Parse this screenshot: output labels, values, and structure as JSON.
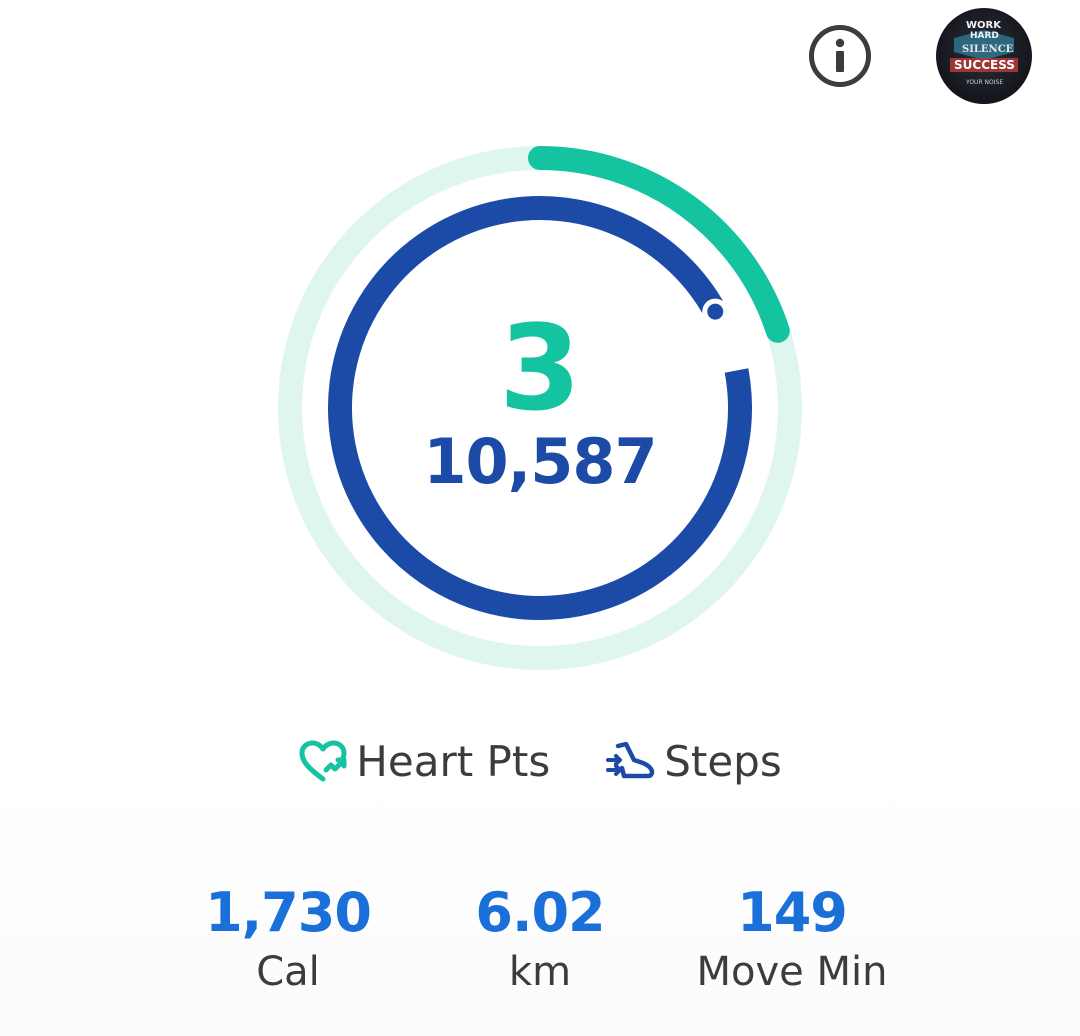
{
  "header": {
    "info_icon": "info-icon",
    "avatar_icon": "avatar-motivational-badge",
    "avatar_text": [
      "WORK",
      "HARD",
      "SILENCE",
      "SUCCESS",
      "YOUR NOISE"
    ]
  },
  "summary": {
    "heart_points": "3",
    "steps": "10,587",
    "heart_progress": 0.2,
    "steps_progress": 0.95
  },
  "legend": {
    "heart_label": "Heart Pts",
    "steps_label": "Steps",
    "heart_icon": "heart-points-icon",
    "steps_icon": "shoe-steps-icon"
  },
  "stats": [
    {
      "value": "1,730",
      "label": "Cal"
    },
    {
      "value": "6.02",
      "label": "km"
    },
    {
      "value": "149",
      "label": "Move Min"
    }
  ],
  "colors": {
    "heart": "#14c3a0",
    "heart_track": "#dff5f0",
    "steps": "#1b4aa7",
    "stat_value": "#1b6fd9",
    "text": "#3c3c3c"
  }
}
